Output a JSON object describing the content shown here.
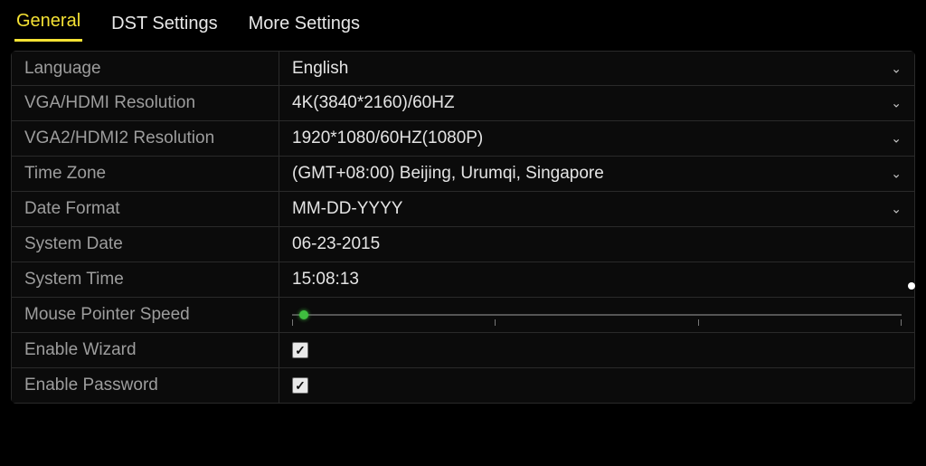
{
  "tabs": {
    "general": "General",
    "dst": "DST Settings",
    "more": "More Settings",
    "active": "general"
  },
  "labels": {
    "language": "Language",
    "res1": "VGA/HDMI Resolution",
    "res2": "VGA2/HDMI2 Resolution",
    "tz": "Time Zone",
    "datefmt": "Date Format",
    "sysdate": "System Date",
    "systime": "System Time",
    "mouse": "Mouse Pointer Speed",
    "wizard": "Enable Wizard",
    "password": "Enable Password"
  },
  "values": {
    "language": "English",
    "res1": "4K(3840*2160)/60HZ",
    "res2": "1920*1080/60HZ(1080P)",
    "tz": "(GMT+08:00) Beijing, Urumqi, Singapore",
    "datefmt": "MM-DD-YYYY",
    "sysdate": "06-23-2015",
    "systime": "15:08:13"
  },
  "mouse_speed": {
    "pos_percent": 2,
    "ticks": 4
  },
  "checks": {
    "wizard": true,
    "password": true
  }
}
